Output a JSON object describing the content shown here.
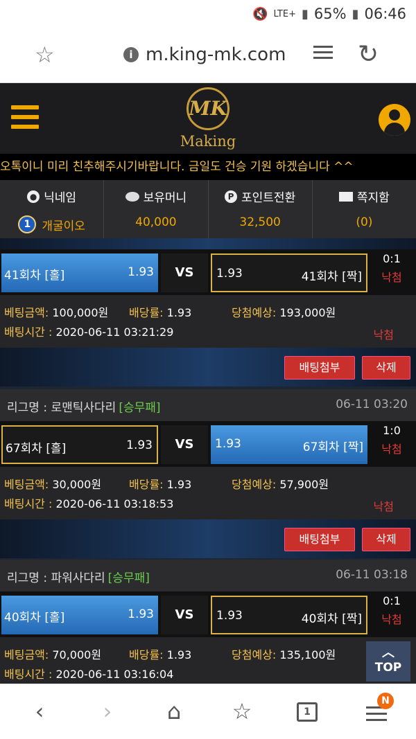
{
  "status_bar": {
    "network": "LTE+",
    "battery": "65%",
    "time": "06:46"
  },
  "browser": {
    "url": "m.king-mk.com",
    "tab_count": "1",
    "menu_badge": "N"
  },
  "site": {
    "logo_text": "MK",
    "brand_name": "Making"
  },
  "notice": "오톡이니 미리 친추해주시기바랍니다. 금일도 건승 기원 하겠습니다 ^^",
  "user_panel": [
    {
      "label": "닉네임",
      "value": "개굴이오",
      "level": "1"
    },
    {
      "label": "보유머니",
      "value": "40,000"
    },
    {
      "label": "포인트전환",
      "value": "32,500"
    },
    {
      "label": "쪽지함",
      "value": "(0)"
    }
  ],
  "labels": {
    "league_prefix": "리그명 : ",
    "vs": "VS",
    "bet_amount": "베팅금액: ",
    "odds": "배당률: ",
    "expected": "당첨예상: ",
    "bet_time": "배팅시간 : ",
    "attach_button": "배팅첨부",
    "delete_button": "삭제",
    "top_button": "TOP"
  },
  "bets": [
    {
      "home_name": "41회차 [홀]",
      "home_odds": "1.93",
      "away_name": "41회차 [짝]",
      "away_odds": "1.93",
      "selected": "away",
      "score": "0:1",
      "result": "낙첨",
      "amount": "100,000원",
      "rate": "1.93",
      "expected": "193,000원",
      "time": "2020-06-11 03:21:29",
      "status": "낙첨"
    },
    {
      "league_name": "로맨틱사다리",
      "bet_type": "[승무패]",
      "league_time": "06-11 03:20",
      "home_name": "67회차 [홀]",
      "home_odds": "1.93",
      "away_name": "67회차 [짝]",
      "away_odds": "1.93",
      "selected": "home",
      "score": "1:0",
      "result": "낙첨",
      "amount": "30,000원",
      "rate": "1.93",
      "expected": "57,900원",
      "time": "2020-06-11 03:18:53",
      "status": "낙첨"
    },
    {
      "league_name": "파워사다리",
      "bet_type": "[승무패]",
      "league_time": "06-11 03:18",
      "home_name": "40회차 [홀]",
      "home_odds": "1.93",
      "away_name": "40회차 [짝]",
      "away_odds": "1.93",
      "selected": "away",
      "score": "0:1",
      "result": "낙첨",
      "amount": "70,000원",
      "rate": "1.93",
      "expected": "135,100원",
      "time": "2020-06-11 03:16:04"
    }
  ]
}
